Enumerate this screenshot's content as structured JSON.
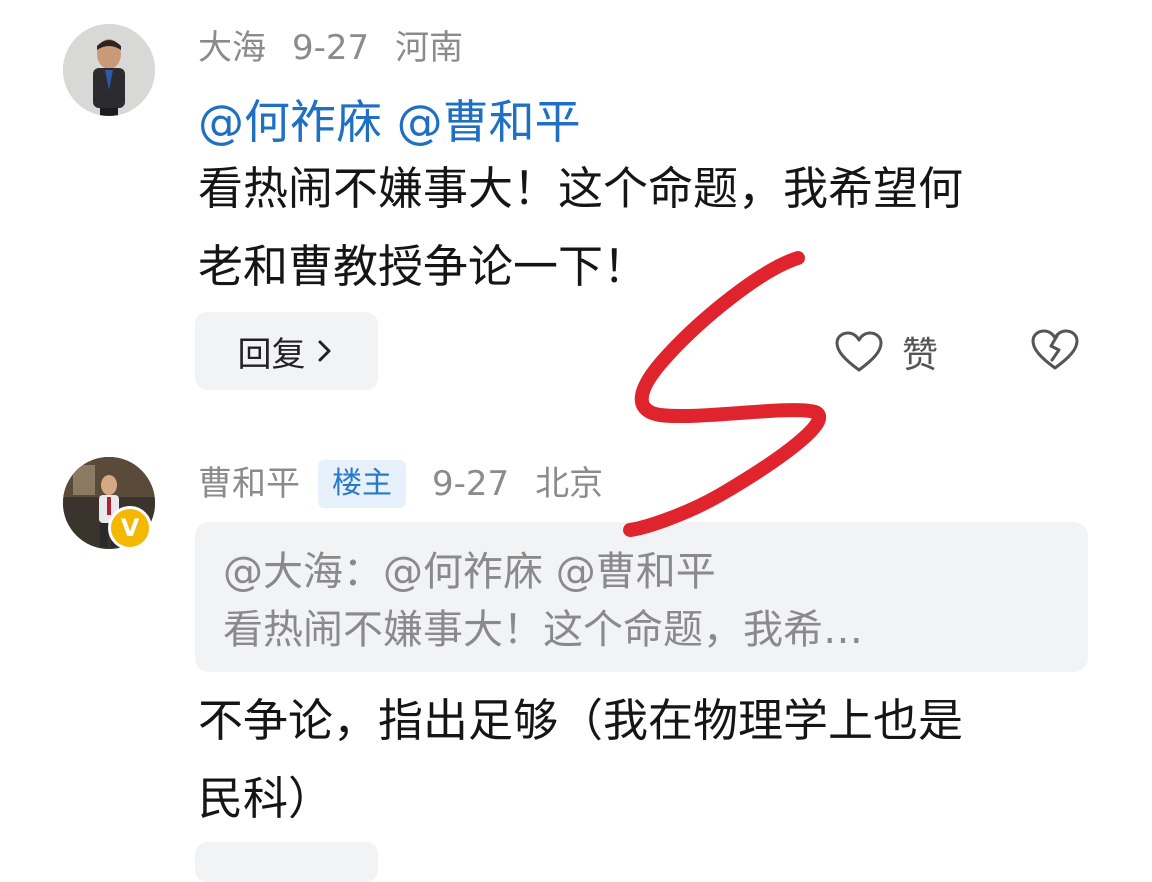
{
  "comments": [
    {
      "author": "大海",
      "date": "9-27",
      "location": "河南",
      "mentions": "@何祚庥 @曹和平",
      "text_line1": "看热闹不嫌事大！这个命题，我希望何",
      "text_line2": "老和曹教授争论一下！",
      "reply_label": "回复",
      "like_label": "赞"
    },
    {
      "author": "曹和平",
      "badge": "楼主",
      "date": "9-27",
      "location": "北京",
      "quote_line1": "@大海：@何祚庥 @曹和平",
      "quote_line2": "看热闹不嫌事大！这个命题，我希…",
      "text_line1": "不争论，指出足够（我在物理学上也是",
      "text_line2": "民科）"
    }
  ],
  "verified_badge": "V",
  "colors": {
    "mention": "#1f6fc2",
    "badge_bg": "#e7f1fb",
    "badge_text": "#2a79c8",
    "annotation_red": "#e0242e",
    "verified_gold": "#f5b800"
  }
}
